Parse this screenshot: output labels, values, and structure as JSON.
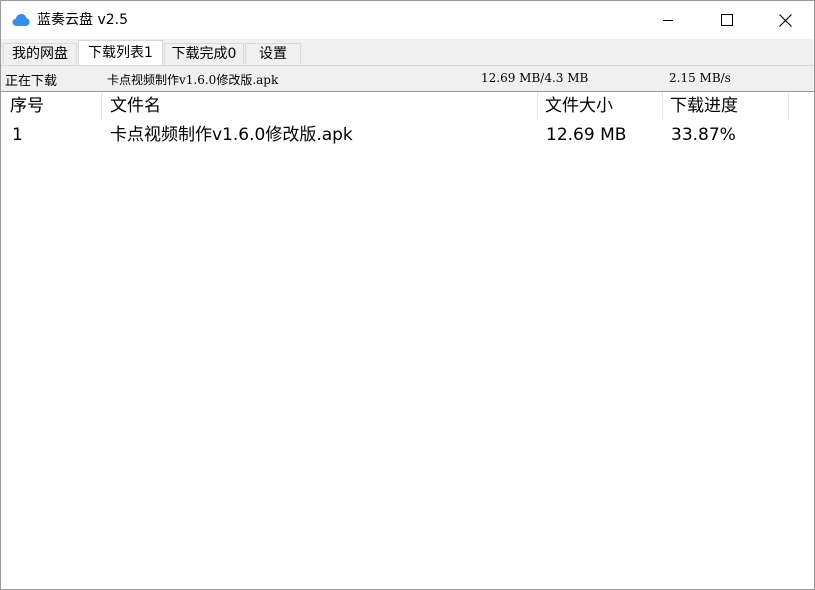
{
  "window": {
    "title": "蓝奏云盘 v2.5",
    "app_icon": "cloud-icon",
    "controls": {
      "minimize": "minimize-icon",
      "maximize": "maximize-icon",
      "close": "close-icon"
    },
    "accent_color": "#3b8ee6"
  },
  "tabs": [
    {
      "label": "我的网盘",
      "active": false
    },
    {
      "label": "下载列表1",
      "active": true
    },
    {
      "label": "下载完成0",
      "active": false
    },
    {
      "label": "设置",
      "active": false
    }
  ],
  "status": {
    "label": "正在下载",
    "file": "卡点视频制作v1.6.0修改版.apk",
    "size": "12.69 MB/4.3 MB",
    "speed": "2.15 MB/s"
  },
  "table": {
    "columns": [
      "序号",
      "文件名",
      "文件大小",
      "下载进度"
    ],
    "rows": [
      {
        "index": "1",
        "name": "卡点视频制作v1.6.0修改版.apk",
        "size": "12.69 MB",
        "progress": "33.87%"
      }
    ]
  }
}
